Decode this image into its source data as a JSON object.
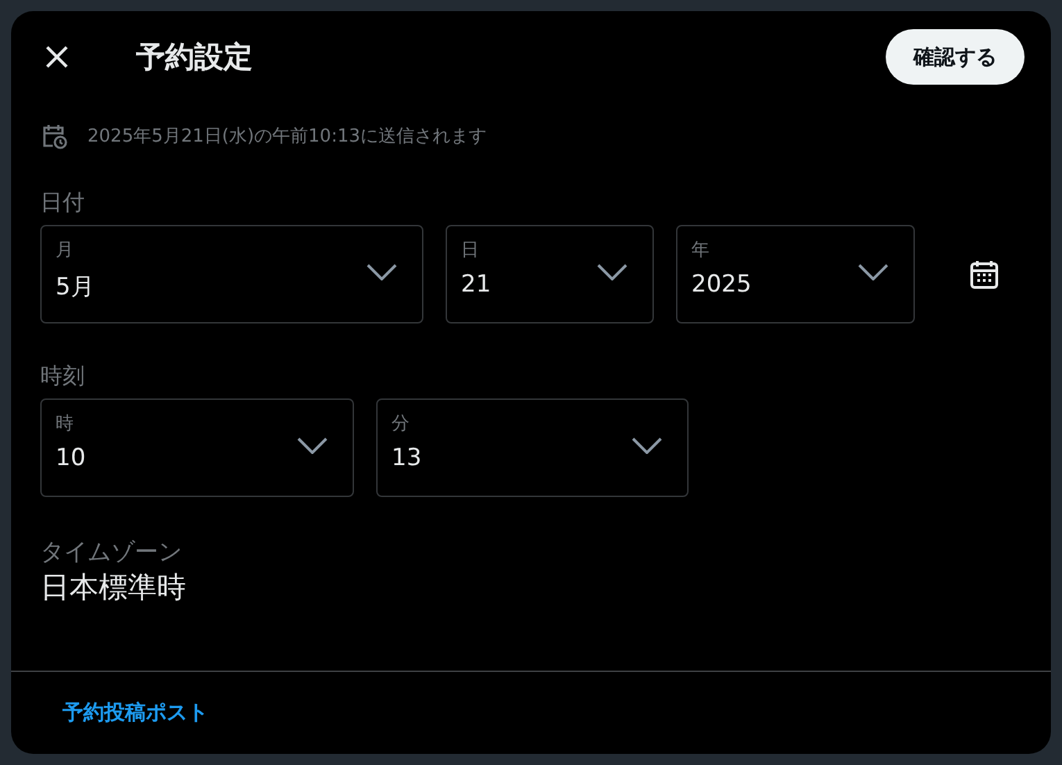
{
  "dialog": {
    "title": "予約設定",
    "confirm_button": "確認する",
    "schedule_note": "2025年5月21日(水)の午前10:13に送信されます",
    "date": {
      "label": "日付",
      "selects": [
        {
          "label": "月",
          "value": "5月"
        },
        {
          "label": "日",
          "value": "21"
        },
        {
          "label": "年",
          "value": "2025"
        }
      ]
    },
    "time": {
      "label": "時刻",
      "selects": [
        {
          "label": "時",
          "value": "10"
        },
        {
          "label": "分",
          "value": "13"
        }
      ]
    },
    "timezone": {
      "label": "タイムゾーン",
      "value": "日本標準時"
    },
    "footer_link": "予約投稿ポスト"
  }
}
